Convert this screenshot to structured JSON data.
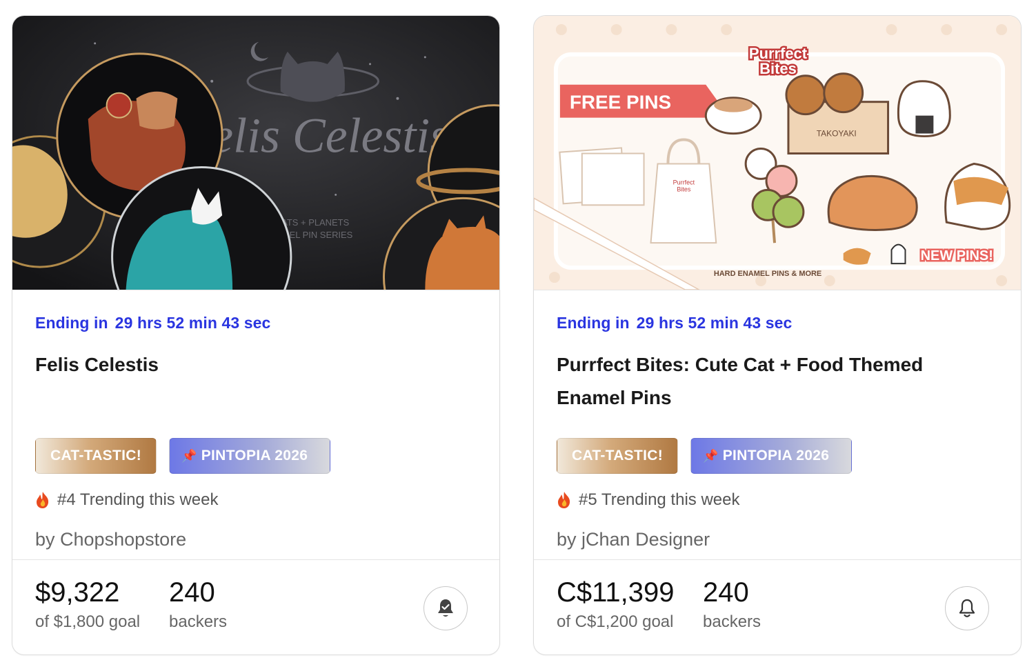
{
  "cards": [
    {
      "hero": {
        "big_title": "Felis Celestis",
        "tagline_1": "A CATS + PLANETS",
        "tagline_2": "ENAMEL PIN SERIES"
      },
      "ending_label": "Ending in",
      "ending_time": "29 hrs 52 min 43 sec",
      "title": "Felis Celestis",
      "badges": [
        {
          "label": "CAT-TASTIC!"
        },
        {
          "icon": "📌",
          "label": "PINTOPIA 2026"
        }
      ],
      "trending_icon": "fire-icon",
      "trending_text": "#4 Trending this week",
      "creator": "by Chopshopstore",
      "pledged": "$9,322",
      "goal": "of $1,800 goal",
      "backers_count": "240",
      "backers_label": "backers",
      "bell_state": "reminder-set"
    },
    {
      "hero": {
        "brand_1": "Purrfect",
        "brand_2": "Bites",
        "free_pins": "FREE PINS",
        "takoyaki": "TAKOYAKI",
        "new_pins": "NEW PINS!",
        "footer_text": "HARD ENAMEL PINS & MORE",
        "bag_text_1": "Purrfect",
        "bag_text_2": "Bites"
      },
      "ending_label": "Ending in",
      "ending_time": "29 hrs 52 min 43 sec",
      "title": "Purrfect Bites: Cute Cat + Food Themed Enamel Pins",
      "badges": [
        {
          "label": "CAT-TASTIC!"
        },
        {
          "icon": "📌",
          "label": "PINTOPIA 2026"
        }
      ],
      "trending_icon": "fire-icon",
      "trending_text": "#5 Trending this week",
      "creator": "by jChan Designer",
      "pledged": "C$11,399",
      "goal": "of C$1,200 goal",
      "backers_count": "240",
      "backers_label": "backers",
      "bell_state": "remind-me"
    }
  ],
  "colors": {
    "accent_blue": "#2a35e0",
    "text_dark": "#1a1a1a",
    "text_muted": "#666666"
  }
}
